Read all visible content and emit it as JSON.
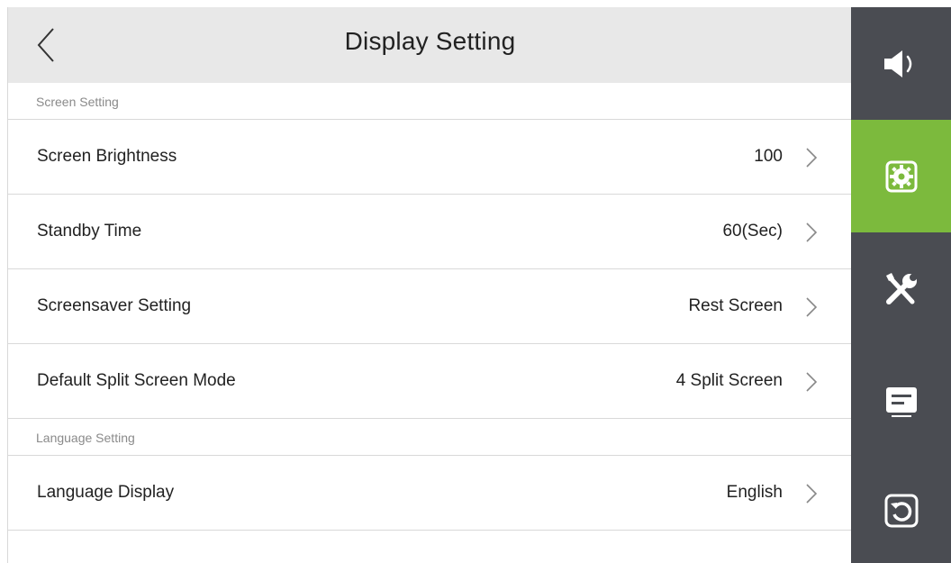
{
  "header": {
    "title": "Display Setting"
  },
  "sections": {
    "screen": {
      "label": "Screen Setting"
    },
    "language": {
      "label": "Language Setting"
    }
  },
  "rows": [
    {
      "label": "Screen Brightness",
      "value": "100"
    },
    {
      "label": "Standby Time",
      "value": "60(Sec)"
    },
    {
      "label": "Screensaver Setting",
      "value": "Rest Screen"
    },
    {
      "label": "Default Split Screen Mode",
      "value": "4 Split Screen"
    },
    {
      "label": "Language Display",
      "value": "English"
    }
  ],
  "sidebar": {
    "items": [
      {
        "icon": "speaker-icon",
        "active": false
      },
      {
        "icon": "settings-gear-icon",
        "active": true
      },
      {
        "icon": "tools-icon",
        "active": false
      },
      {
        "icon": "message-icon",
        "active": false
      },
      {
        "icon": "restart-icon",
        "active": false
      }
    ]
  },
  "colors": {
    "header_bg": "#e8e8e8",
    "sidebar_bg": "#4a4c52",
    "accent_green": "#7cba3d",
    "divider": "#d9d9d9",
    "section_text": "#8a8a8a"
  }
}
